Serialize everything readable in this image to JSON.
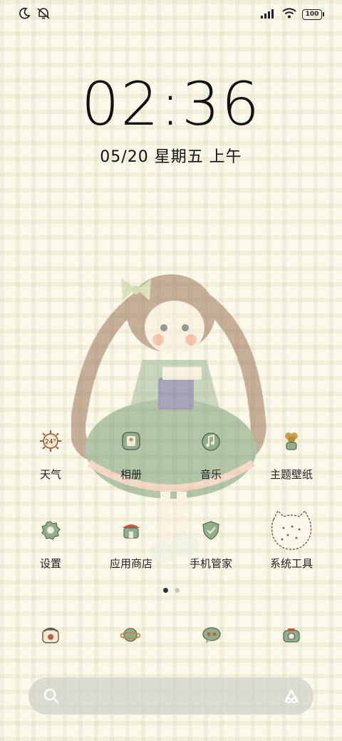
{
  "status_bar": {
    "battery": "100",
    "icons": [
      "moon-icon",
      "mute-icon",
      "signal-icon",
      "wifi-icon",
      "battery-icon"
    ]
  },
  "lockscreen": {
    "time": "02:36",
    "date": "05/20 星期五 上午"
  },
  "apps_row1": [
    {
      "label": "天气",
      "icon": "weather-icon",
      "badge": "24°"
    },
    {
      "label": "相册",
      "icon": "gallery-icon"
    },
    {
      "label": "音乐",
      "icon": "music-icon"
    },
    {
      "label": "主题壁纸",
      "icon": "theme-icon"
    }
  ],
  "apps_row2": [
    {
      "label": "设置",
      "icon": "settings-icon"
    },
    {
      "label": "应用商店",
      "icon": "app-store-icon"
    },
    {
      "label": "手机管家",
      "icon": "security-icon"
    },
    {
      "label": "系统工具",
      "icon": "system-tools-folder-icon"
    }
  ],
  "page_indicator": {
    "pages": 2,
    "current": 1
  },
  "dock": [
    "phone-icon",
    "browser-icon",
    "messages-icon",
    "camera-icon"
  ],
  "colors": {
    "background": "#fbf9e9",
    "icon_green": "#8fae8c",
    "icon_brown": "#8a5a3c"
  }
}
